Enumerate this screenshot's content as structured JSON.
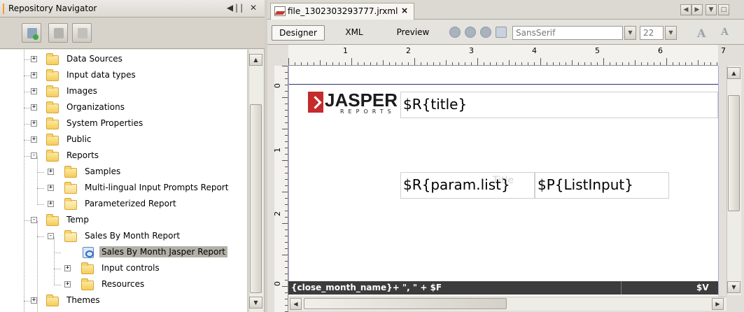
{
  "navigator": {
    "title": "Repository Navigator",
    "title_controls": "◀|| ✕",
    "tree": [
      {
        "label": "Data Sources",
        "type": "folder",
        "expand": "+"
      },
      {
        "label": "Input data types",
        "type": "folder",
        "expand": "+"
      },
      {
        "label": "Images",
        "type": "folder",
        "expand": "+"
      },
      {
        "label": "Organizations",
        "type": "folder",
        "expand": "+"
      },
      {
        "label": "System Properties",
        "type": "folder",
        "expand": "+"
      },
      {
        "label": "Public",
        "type": "folder",
        "expand": "+"
      },
      {
        "label": "Reports",
        "type": "folder",
        "expand": "-"
      },
      {
        "label": "Samples",
        "type": "folder",
        "expand": "+"
      },
      {
        "label": "Multi-lingual Input Prompts Report",
        "type": "report-folder",
        "expand": "+"
      },
      {
        "label": "Parameterized Report",
        "type": "report-folder",
        "expand": "+"
      },
      {
        "label": "Temp",
        "type": "folder",
        "expand": "-"
      },
      {
        "label": "Sales By Month Report",
        "type": "report-folder",
        "expand": "-"
      },
      {
        "label": "Sales By Month Jasper Report",
        "type": "jrxml",
        "expand": "",
        "selected": true
      },
      {
        "label": "Input controls",
        "type": "folder",
        "expand": "+"
      },
      {
        "label": "Resources",
        "type": "folder",
        "expand": "+"
      },
      {
        "label": "Themes",
        "type": "folder",
        "expand": "+"
      }
    ]
  },
  "editor": {
    "tab_title": "file_1302303293777.jrxml",
    "tab_close": "×",
    "modes": [
      "Designer",
      "XML",
      "Preview"
    ],
    "active_mode": "Designer",
    "font_name": "SansSerif",
    "font_size": "22",
    "ruler_h": [
      "1",
      "2",
      "3",
      "4",
      "5",
      "6",
      "7"
    ],
    "ruler_v": [
      "0",
      "1",
      "2",
      "0"
    ],
    "logo_word": "JASPER",
    "logo_sub": "REPORTS",
    "field_title": "$R{title}",
    "field_param_list": "$R{param.list}",
    "field_list_input": "$P{ListInput}",
    "ghost_text": "Title",
    "footer_expr": "{close_month_name}+ \", \" + $F",
    "footer_var": "$V"
  },
  "colors": {
    "selection": "#b3b0a8",
    "footer_band": "#3c3c3c",
    "logo_red": "#c52b2b",
    "folder": "#f5cd58"
  }
}
